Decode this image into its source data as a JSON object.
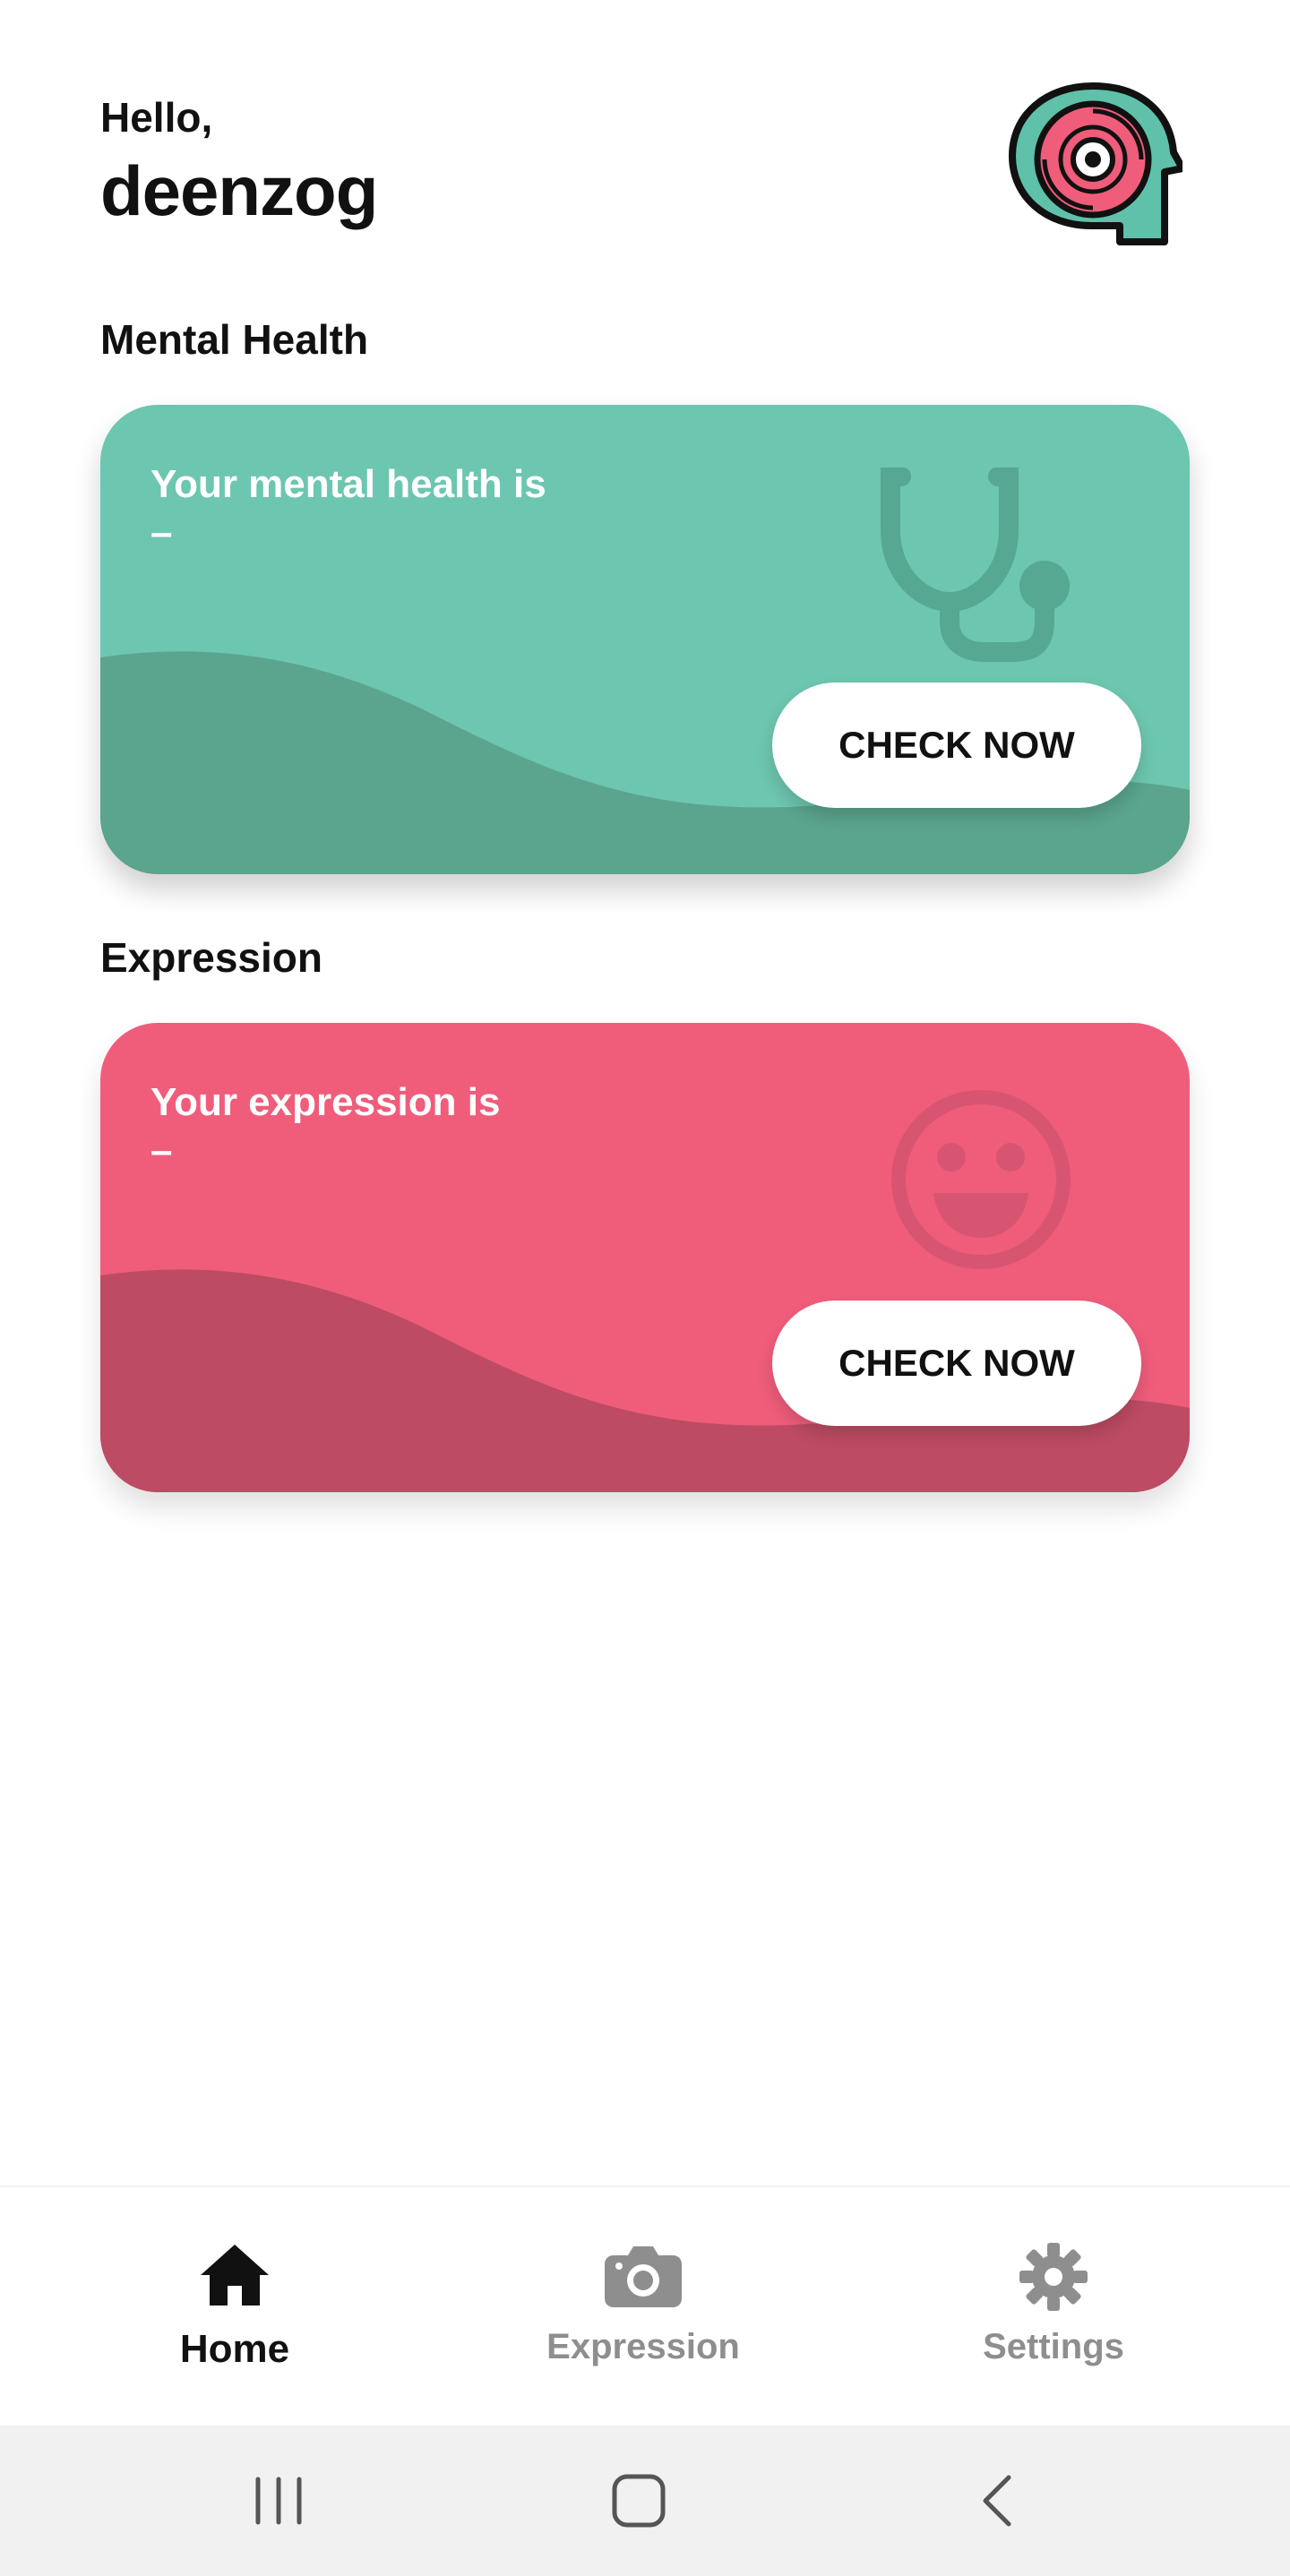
{
  "header": {
    "greeting": "Hello,",
    "username": "deenzog",
    "avatar_icon": "brain-target-logo-icon"
  },
  "sections": {
    "mental_health": {
      "title": "Mental Health",
      "card_label": "Your mental health is",
      "card_value": "–",
      "button_label": "CHECK NOW",
      "icon": "stethoscope-icon",
      "color": "#6dc6af",
      "wave_color": "#5ba48e"
    },
    "expression": {
      "title": "Expression",
      "card_label": "Your expression is",
      "card_value": "–",
      "button_label": "CHECK NOW",
      "icon": "smile-face-icon",
      "color": "#ef5d7b",
      "wave_color": "#bd4b63"
    }
  },
  "bottom_nav": {
    "items": [
      {
        "label": "Home",
        "icon": "home-icon",
        "active": true
      },
      {
        "label": "Expression",
        "icon": "camera-icon",
        "active": false
      },
      {
        "label": "Settings",
        "icon": "gear-icon",
        "active": false
      }
    ]
  },
  "system_nav": {
    "recents_icon": "recents-icon",
    "home_icon": "home-square-icon",
    "back_icon": "back-chevron-icon"
  }
}
